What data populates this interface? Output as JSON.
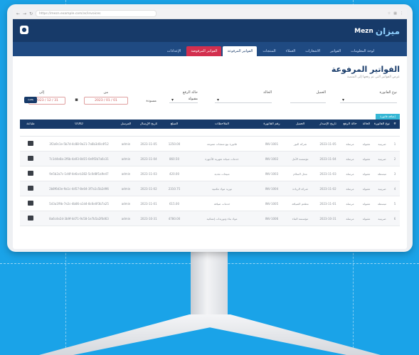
{
  "browser": {
    "url": "https://mezn.example.com/ar/invoices"
  },
  "header": {
    "logo_text": "Mezn",
    "logo_mark": "ميزان"
  },
  "nav": {
    "tabs": [
      {
        "label": "لوحة المعلومات"
      },
      {
        "label": "الفواتير"
      },
      {
        "label": "الاشعارات"
      },
      {
        "label": "العملاء"
      },
      {
        "label": "المنتجات"
      },
      {
        "label": "الفواتير المرفوعة",
        "active": true
      },
      {
        "label": "الفواتير المرفوضة",
        "alert": true
      },
      {
        "label": "الإعدادات"
      }
    ]
  },
  "page": {
    "title": "الفواتير المرفوعة",
    "subtitle": "عرض الفواتير التي تم رفعها إلى المنصة"
  },
  "filters": {
    "invoice_type_label": "نوع الفاتورة",
    "client_label": "العميل",
    "status_label": "الحالة",
    "submit_status_label": "حالة الرفع",
    "submit_status_value": "مقبولة",
    "draft_label": "مسودة",
    "from_label": "من",
    "from_value": "01 / 01 / 2023",
    "to_label": "إلى",
    "to_value": "31 / 12 / 2023",
    "search_label": "بحث"
  },
  "add_button": "إضافة فاتورة",
  "table": {
    "columns": [
      "#",
      "نوع الفاتورة",
      "الحالة",
      "حالة الرفع",
      "تاريخ الإصدار",
      "العميل",
      "رقم الفاتورة",
      "الملاحظات",
      "المبلغ",
      "تاريخ الإرسال",
      "المرسل",
      "UUID",
      "طباعة"
    ],
    "rows": [
      [
        "1",
        "ضريبية",
        "مقبولة",
        "مرسلة",
        "2023-11-05",
        "شركة النور",
        "INV-1001",
        "فاتورة بيع منتجات متنوعة",
        "1250.00",
        "2023-11-05",
        "admin",
        "3f2a9c1e-5b7d-4c88-9e21-7a6b3d0c4f12",
        ""
      ],
      [
        "2",
        "ضريبية",
        "مقبولة",
        "مرسلة",
        "2023-11-04",
        "مؤسسة الأمل",
        "INV-1002",
        "خدمات صيانة شهرية للأجهزة",
        "860.50",
        "2023-11-04",
        "admin",
        "7c1d4e8a-2f6b-4a93-8d15-0e9f2b7a6c31",
        ""
      ],
      [
        "3",
        "مبسطة",
        "مقبولة",
        "مرسلة",
        "2023-11-03",
        "محل السلام",
        "INV-1003",
        "مبيعات نقدية",
        "420.00",
        "2023-11-03",
        "admin",
        "9e5b2a7c-1d4f-4e6a-b382-5c0d8f1a9e47",
        ""
      ],
      [
        "4",
        "ضريبية",
        "مقبولة",
        "مرسلة",
        "2023-11-02",
        "شركة الريادة",
        "INV-1004",
        "توريد مواد مكتبية",
        "2310.75",
        "2023-11-02",
        "admin",
        "2b8f6d3e-9a1c-4d57-8e04-3f7a1c5b2d96",
        ""
      ],
      [
        "5",
        "مبسطة",
        "مقبولة",
        "مرسلة",
        "2023-11-01",
        "مطعم الضيافة",
        "INV-1005",
        "خدمات ضيافة",
        "615.00",
        "2023-11-01",
        "admin",
        "5d3a1f9b-7e2c-4b86-a1d4-8c6e0f3b7a25",
        ""
      ],
      [
        "6",
        "ضريبية",
        "مقبولة",
        "مرسلة",
        "2023-10-31",
        "مؤسسة البناء",
        "INV-1006",
        "مواد بناء وتوريدات إنشائية",
        "4780.00",
        "2023-10-31",
        "admin",
        "8a6c4e2d-3b9f-4d71-9c58-1e7b5a2f0d63",
        ""
      ]
    ]
  },
  "colors": {
    "header_bg": "#173a69",
    "nav_bg": "#1f4a82",
    "alert_tab": "#d32f4e",
    "accent": "#36b7d5",
    "page_bg": "#1aa3e8"
  }
}
